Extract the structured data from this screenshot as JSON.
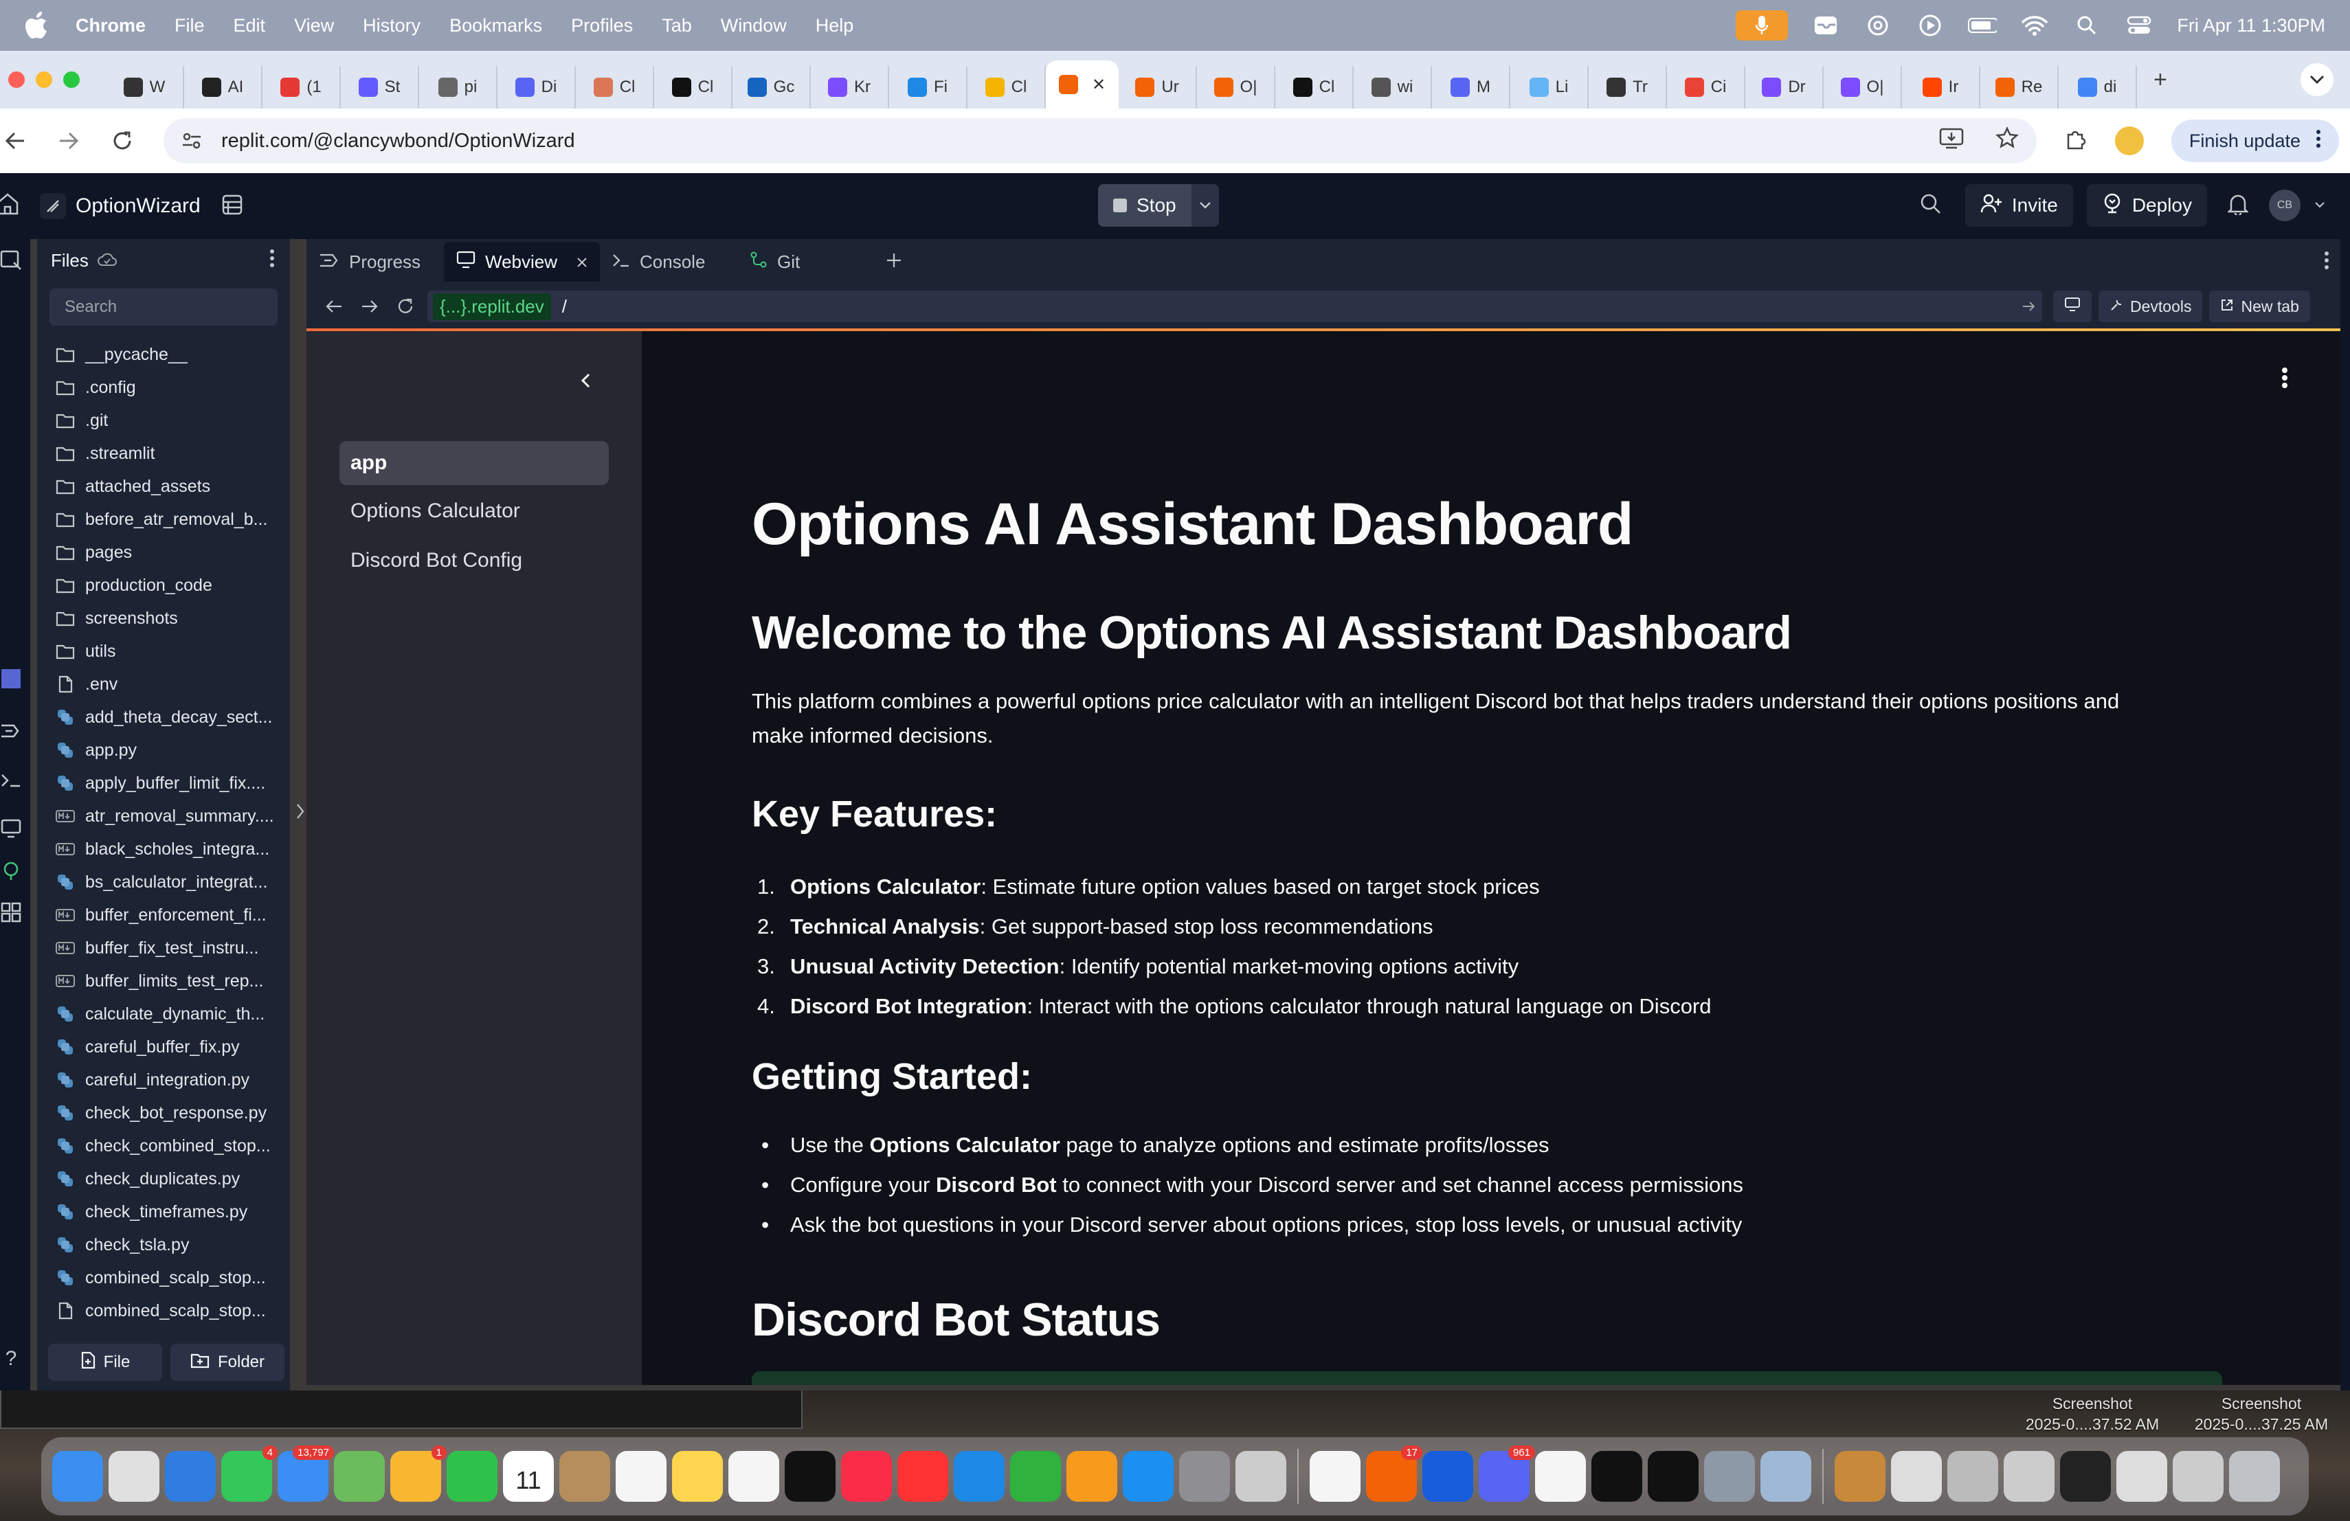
{
  "menubar": {
    "app": "Chrome",
    "items": [
      "File",
      "Edit",
      "View",
      "History",
      "Bookmarks",
      "Profiles",
      "Tab",
      "Window",
      "Help"
    ],
    "datetime": "Fri Apr 11  1:30PM"
  },
  "tabs": [
    {
      "label": "W",
      "color": "#333333"
    },
    {
      "label": "AI",
      "color": "#222222"
    },
    {
      "label": "(1",
      "color": "#e53935"
    },
    {
      "label": "St",
      "color": "#635bff"
    },
    {
      "label": "pi",
      "color": "#666666"
    },
    {
      "label": "Di",
      "color": "#5865f2"
    },
    {
      "label": "Cl",
      "color": "#d97757"
    },
    {
      "label": "Cl",
      "color": "#111111"
    },
    {
      "label": "Gc",
      "color": "#1565c0"
    },
    {
      "label": "Kr",
      "color": "#7c4dff"
    },
    {
      "label": "Fi",
      "color": "#1e88e5"
    },
    {
      "label": "Cl",
      "color": "#f4b400"
    },
    {
      "label": "",
      "color": "#f26207",
      "active": true
    },
    {
      "label": "Ur",
      "color": "#f26207"
    },
    {
      "label": "O|",
      "color": "#f26207"
    },
    {
      "label": "Cl",
      "color": "#111111"
    },
    {
      "label": "wi",
      "color": "#555555"
    },
    {
      "label": "M",
      "color": "#5865f2"
    },
    {
      "label": "Li",
      "color": "#64b5f6"
    },
    {
      "label": "Tr",
      "color": "#333333"
    },
    {
      "label": "Ci",
      "color": "#ea4335"
    },
    {
      "label": "Dr",
      "color": "#7b4dff"
    },
    {
      "label": "O|",
      "color": "#7b4dff"
    },
    {
      "label": "Ir",
      "color": "#ff4500"
    },
    {
      "label": "Re",
      "color": "#f26207"
    },
    {
      "label": "di",
      "color": "#4285f4"
    }
  ],
  "addressbar": {
    "url": "replit.com/@clancywbond/OptionWizard",
    "finish_update": "Finish update"
  },
  "replit": {
    "project_name": "OptionWizard",
    "stop_label": "Stop",
    "invite_label": "Invite",
    "deploy_label": "Deploy",
    "avatar_initials": "CB"
  },
  "files_panel": {
    "title": "Files",
    "search_placeholder": "Search",
    "items": [
      {
        "name": "__pycache__",
        "type": "folder"
      },
      {
        "name": ".config",
        "type": "folder"
      },
      {
        "name": ".git",
        "type": "folder"
      },
      {
        "name": ".streamlit",
        "type": "folder"
      },
      {
        "name": "attached_assets",
        "type": "folder"
      },
      {
        "name": "before_atr_removal_b...",
        "type": "folder"
      },
      {
        "name": "pages",
        "type": "folder"
      },
      {
        "name": "production_code",
        "type": "folder"
      },
      {
        "name": "screenshots",
        "type": "folder"
      },
      {
        "name": "utils",
        "type": "folder"
      },
      {
        "name": ".env",
        "type": "file"
      },
      {
        "name": "add_theta_decay_sect...",
        "type": "python"
      },
      {
        "name": "app.py",
        "type": "python"
      },
      {
        "name": "apply_buffer_limit_fix....",
        "type": "python"
      },
      {
        "name": "atr_removal_summary....",
        "type": "markdown"
      },
      {
        "name": "black_scholes_integra...",
        "type": "markdown"
      },
      {
        "name": "bs_calculator_integrat...",
        "type": "python"
      },
      {
        "name": "buffer_enforcement_fi...",
        "type": "markdown"
      },
      {
        "name": "buffer_fix_test_instru...",
        "type": "markdown"
      },
      {
        "name": "buffer_limits_test_rep...",
        "type": "markdown"
      },
      {
        "name": "calculate_dynamic_th...",
        "type": "python"
      },
      {
        "name": "careful_buffer_fix.py",
        "type": "python"
      },
      {
        "name": "careful_integration.py",
        "type": "python"
      },
      {
        "name": "check_bot_response.py",
        "type": "python"
      },
      {
        "name": "check_combined_stop...",
        "type": "python"
      },
      {
        "name": "check_duplicates.py",
        "type": "python"
      },
      {
        "name": "check_timeframes.py",
        "type": "python"
      },
      {
        "name": "check_tsla.py",
        "type": "python"
      },
      {
        "name": "combined_scalp_stop...",
        "type": "python"
      },
      {
        "name": "combined_scalp_stop...",
        "type": "file"
      }
    ],
    "new_file": "File",
    "new_folder": "Folder"
  },
  "pane_tabs": [
    {
      "label": "Progress",
      "icon": "progress-icon"
    },
    {
      "label": "Webview",
      "icon": "monitor-icon",
      "active": true
    },
    {
      "label": "Console",
      "icon": "terminal-icon"
    },
    {
      "label": "Git",
      "icon": "git-icon"
    }
  ],
  "webview": {
    "domain": "{...}.replit.dev",
    "path": "/",
    "devtools": "Devtools",
    "newtab": "New tab"
  },
  "app": {
    "nav": [
      "app",
      "Options Calculator",
      "Discord Bot Config"
    ],
    "title": "Options AI Assistant Dashboard",
    "welcome": "Welcome to the Options AI Assistant Dashboard",
    "intro": "This platform combines a powerful options price calculator with an intelligent Discord bot that helps traders understand their options positions and make informed decisions.",
    "features_heading": "Key Features:",
    "features": [
      {
        "num": "1.",
        "bold": "Options Calculator",
        "text": ": Estimate future option values based on target stock prices"
      },
      {
        "num": "2.",
        "bold": "Technical Analysis",
        "text": ": Get support-based stop loss recommendations"
      },
      {
        "num": "3.",
        "bold": "Unusual Activity Detection",
        "text": ": Identify potential market-moving options activity"
      },
      {
        "num": "4.",
        "bold": "Discord Bot Integration",
        "text": ": Interact with the options calculator through natural language on Discord"
      }
    ],
    "getting_started_heading": "Getting Started:",
    "getting_started": [
      {
        "pre": "Use the ",
        "bold": "Options Calculator",
        "post": " page to analyze options and estimate profits/losses"
      },
      {
        "pre": "Configure your ",
        "bold": "Discord Bot",
        "post": " to connect with your Discord server and set channel access permissions"
      },
      {
        "pre": "Ask the bot questions in your Discord server about options prices, stop loss levels, or unusual activity",
        "bold": "",
        "post": ""
      }
    ],
    "status_heading": "Discord Bot Status"
  },
  "desktop": {
    "shot1": {
      "line1": "Screenshot",
      "line2": "2025-0....37.52 AM"
    },
    "shot2": {
      "line1": "Screenshot",
      "line2": "2025-0....37.25 AM"
    }
  },
  "dock": {
    "apps": [
      {
        "name": "finder",
        "color": "#3b8ff0"
      },
      {
        "name": "launchpad",
        "color": "#e0e0e0"
      },
      {
        "name": "safari",
        "color": "#2f7de1"
      },
      {
        "name": "messages",
        "color": "#34c759",
        "badge": "4"
      },
      {
        "name": "mail",
        "color": "#3a8ef5",
        "badge": "13,797"
      },
      {
        "name": "maps",
        "color": "#6bbd5b"
      },
      {
        "name": "photos",
        "color": "#f7b731",
        "badge": "1"
      },
      {
        "name": "facetime",
        "color": "#2fc24b"
      },
      {
        "name": "calendar",
        "color": "#ffffff",
        "text": "11"
      },
      {
        "name": "contacts",
        "color": "#b58e5c"
      },
      {
        "name": "reminders",
        "color": "#f5f5f5"
      },
      {
        "name": "notes",
        "color": "#ffd54f"
      },
      {
        "name": "freeform",
        "color": "#f5f5f5"
      },
      {
        "name": "tv",
        "color": "#111111"
      },
      {
        "name": "music",
        "color": "#fa2d48"
      },
      {
        "name": "news",
        "color": "#f33"
      },
      {
        "name": "keynote",
        "color": "#1e88e5"
      },
      {
        "name": "numbers",
        "color": "#30b33e"
      },
      {
        "name": "pages",
        "color": "#f89a1c"
      },
      {
        "name": "app-store",
        "color": "#1b8ff2"
      },
      {
        "name": "system-settings",
        "color": "#8e8e93"
      },
      {
        "name": "iphone-mirroring",
        "color": "#cccccc"
      },
      {
        "name": "chrome",
        "color": "#f5f5f5"
      },
      {
        "name": "replit",
        "color": "#f26207",
        "badge": "17"
      },
      {
        "name": "bitwarden",
        "color": "#175ddc"
      },
      {
        "name": "discord",
        "color": "#5865f2",
        "badge": "961"
      },
      {
        "name": "sonos",
        "color": "#f5f5f5"
      },
      {
        "name": "chatgpt",
        "color": "#111111"
      },
      {
        "name": "tradingview",
        "color": "#111111"
      },
      {
        "name": "downloads",
        "color": "#8e99a8"
      },
      {
        "name": "preview",
        "color": "#9fb8d6"
      },
      {
        "name": "archive",
        "color": "#c9893b"
      },
      {
        "name": "doc-1",
        "color": "#dddddd"
      },
      {
        "name": "doc-2",
        "color": "#bbbbbb"
      },
      {
        "name": "doc-3",
        "color": "#cccccc"
      },
      {
        "name": "doc-4",
        "color": "#222222"
      },
      {
        "name": "doc-5",
        "color": "#dddddd"
      },
      {
        "name": "doc-6",
        "color": "#cccccc"
      },
      {
        "name": "trash",
        "color": "#bfc3c8"
      }
    ]
  }
}
